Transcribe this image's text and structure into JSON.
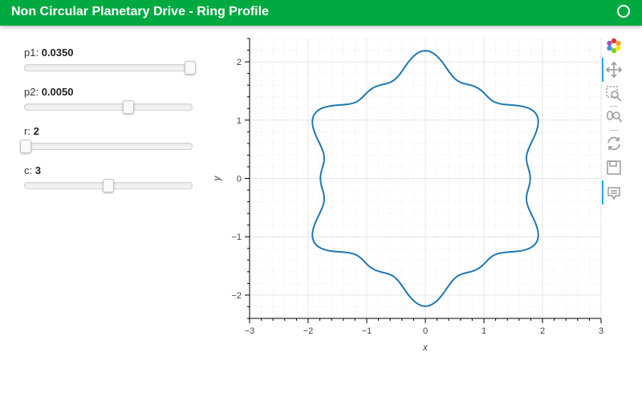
{
  "header": {
    "title": "Non Circular Planetary Drive - Ring Profile"
  },
  "widgets": [
    {
      "label": "p1:",
      "value": "0.0350",
      "fraction": 0.995
    },
    {
      "label": "p2:",
      "value": "0.0050",
      "fraction": 0.62
    },
    {
      "label": "r:",
      "value": "2",
      "fraction": 0.0
    },
    {
      "label": "c:",
      "value": "3",
      "fraction": 0.5
    }
  ],
  "toolbar": [
    "bokeh-logo-icon",
    "pan-icon",
    "box-zoom-icon",
    "wheel-zoom-icon",
    "reset-icon",
    "save-icon",
    "hover-icon"
  ],
  "chart_data": {
    "type": "line",
    "xlabel": "x",
    "ylabel": "y",
    "xlim": [
      -3,
      3
    ],
    "ylim": [
      -2.4,
      2.4
    ],
    "xticks": [
      "−3",
      "−2",
      "−1",
      "0",
      "1",
      "2",
      "3"
    ],
    "yticks": [
      "−2",
      "−1",
      "0",
      "1",
      "2"
    ],
    "grid": true,
    "series": [
      {
        "color": "#1f77b4",
        "lobes": 6,
        "base_radius": 1.9,
        "amplitude": 0.2,
        "harmonic": 0.09
      }
    ]
  }
}
